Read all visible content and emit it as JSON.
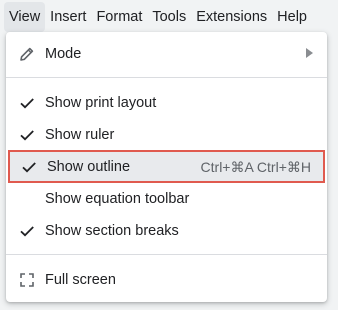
{
  "menubar": {
    "items": [
      "View",
      "Insert",
      "Format",
      "Tools",
      "Extensions",
      "Help"
    ]
  },
  "menu": {
    "mode": {
      "label": "Mode",
      "icon": "pencil-icon"
    },
    "print_layout": {
      "label": "Show print layout",
      "checked": true
    },
    "ruler": {
      "label": "Show ruler",
      "checked": true
    },
    "outline": {
      "label": "Show outline",
      "checked": true,
      "shortcut": "Ctrl+⌘A Ctrl+⌘H",
      "highlighted": true,
      "highlight_color": "#e05a4f"
    },
    "equation": {
      "label": "Show equation toolbar",
      "checked": false
    },
    "section_breaks": {
      "label": "Show section breaks",
      "checked": true
    },
    "full_screen": {
      "label": "Full screen",
      "icon": "fullscreen-icon"
    }
  }
}
